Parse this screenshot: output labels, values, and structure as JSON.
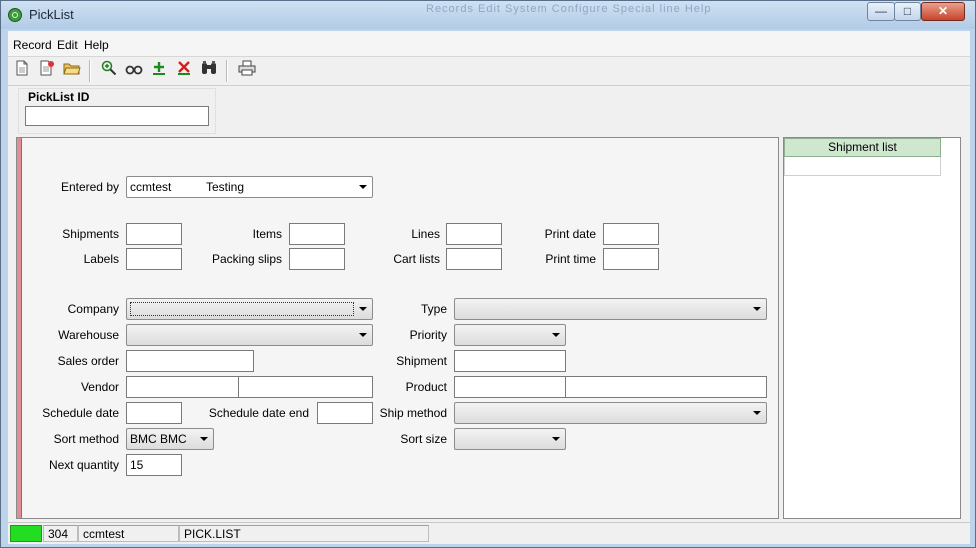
{
  "window": {
    "title": "PickList",
    "background_text": "Records Edit System Configure Special line Help",
    "buttons": {
      "minimize": "—",
      "maximize": "□",
      "close": "✕"
    }
  },
  "menu": {
    "items": [
      "Record",
      "Edit",
      "Help"
    ]
  },
  "toolbar": {
    "icons": [
      "new-document-icon",
      "new-copy-icon",
      "open-folder-icon",
      "zoom-in-icon",
      "view-glasses-icon",
      "add-plus-icon",
      "delete-x-icon",
      "find-binoculars-icon",
      "print-icon"
    ]
  },
  "picklist_id": {
    "label": "PickList ID",
    "value": ""
  },
  "form": {
    "entered_by": {
      "label": "Entered by",
      "value": "ccmtest",
      "value2": "Testing"
    },
    "shipments": {
      "label": "Shipments",
      "value": ""
    },
    "items": {
      "label": "Items",
      "value": ""
    },
    "lines": {
      "label": "Lines",
      "value": ""
    },
    "print_date": {
      "label": "Print date",
      "value": ""
    },
    "labels": {
      "label": "Labels",
      "value": ""
    },
    "packing_slips": {
      "label": "Packing slips",
      "value": ""
    },
    "cart_lists": {
      "label": "Cart lists",
      "value": ""
    },
    "print_time": {
      "label": "Print time",
      "value": ""
    },
    "company": {
      "label": "Company",
      "value": ""
    },
    "type": {
      "label": "Type",
      "value": ""
    },
    "warehouse": {
      "label": "Warehouse",
      "value": ""
    },
    "priority": {
      "label": "Priority",
      "value": ""
    },
    "sales_order": {
      "label": "Sales order",
      "value": ""
    },
    "shipment": {
      "label": "Shipment",
      "value": ""
    },
    "vendor": {
      "label": "Vendor",
      "value": "",
      "value2": ""
    },
    "product": {
      "label": "Product",
      "value": "",
      "value2": ""
    },
    "schedule_date": {
      "label": "Schedule date",
      "value": ""
    },
    "schedule_date_end": {
      "label": "Schedule date end",
      "value": ""
    },
    "ship_method": {
      "label": "Ship method",
      "value": ""
    },
    "sort_method": {
      "label": "Sort method",
      "value": "BMC BMC"
    },
    "sort_size": {
      "label": "Sort size",
      "value": ""
    },
    "next_quantity": {
      "label": "Next quantity",
      "value": "15"
    }
  },
  "side_panel": {
    "header": "Shipment list"
  },
  "status": {
    "indicator_color": "#22dd22",
    "count": "304",
    "user": "ccmtest",
    "program": "PICK.LIST"
  },
  "colors": {
    "accent_bar": "#e08f95",
    "side_header": "#cfe6cf"
  }
}
